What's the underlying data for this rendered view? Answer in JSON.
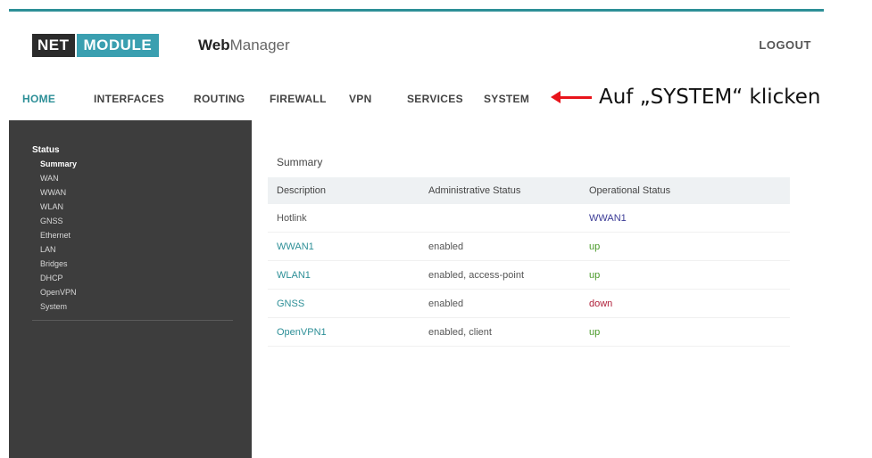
{
  "brand": {
    "logo_left": "NET",
    "logo_right": "MODULE",
    "app_name_bold": "Web",
    "app_name_light": "Manager"
  },
  "header": {
    "logout_label": "LOGOUT"
  },
  "nav": {
    "items": [
      {
        "label": "HOME"
      },
      {
        "label": "INTERFACES"
      },
      {
        "label": "ROUTING"
      },
      {
        "label": "FIREWALL"
      },
      {
        "label": "VPN"
      },
      {
        "label": "SERVICES"
      },
      {
        "label": "SYSTEM"
      }
    ],
    "active": "HOME"
  },
  "annotation": {
    "text": "Auf „SYSTEM“ klicken",
    "arrow_color": "#e8141b"
  },
  "sidebar": {
    "title": "Status",
    "items": [
      {
        "label": "Summary"
      },
      {
        "label": "WAN"
      },
      {
        "label": "WWAN"
      },
      {
        "label": "WLAN"
      },
      {
        "label": "GNSS"
      },
      {
        "label": "Ethernet"
      },
      {
        "label": "LAN"
      },
      {
        "label": "Bridges"
      },
      {
        "label": "DHCP"
      },
      {
        "label": "OpenVPN"
      },
      {
        "label": "System"
      }
    ],
    "active": "Summary"
  },
  "summary": {
    "title": "Summary",
    "columns": [
      "Description",
      "Administrative Status",
      "Operational Status"
    ],
    "rows": [
      {
        "description": "Hotlink",
        "admin": "",
        "operational": "WWAN1"
      },
      {
        "description": "WWAN1",
        "admin": "enabled",
        "operational": "up"
      },
      {
        "description": "WLAN1",
        "admin": "enabled, access-point",
        "operational": "up"
      },
      {
        "description": "GNSS",
        "admin": "enabled",
        "operational": "down"
      },
      {
        "description": "OpenVPN1",
        "admin": "enabled, client",
        "operational": "up"
      }
    ]
  },
  "colors": {
    "accent": "#2d8f97",
    "sidebar_bg": "#3d3d3d",
    "status_up": "#4a9a2a",
    "status_down": "#b0203a"
  }
}
